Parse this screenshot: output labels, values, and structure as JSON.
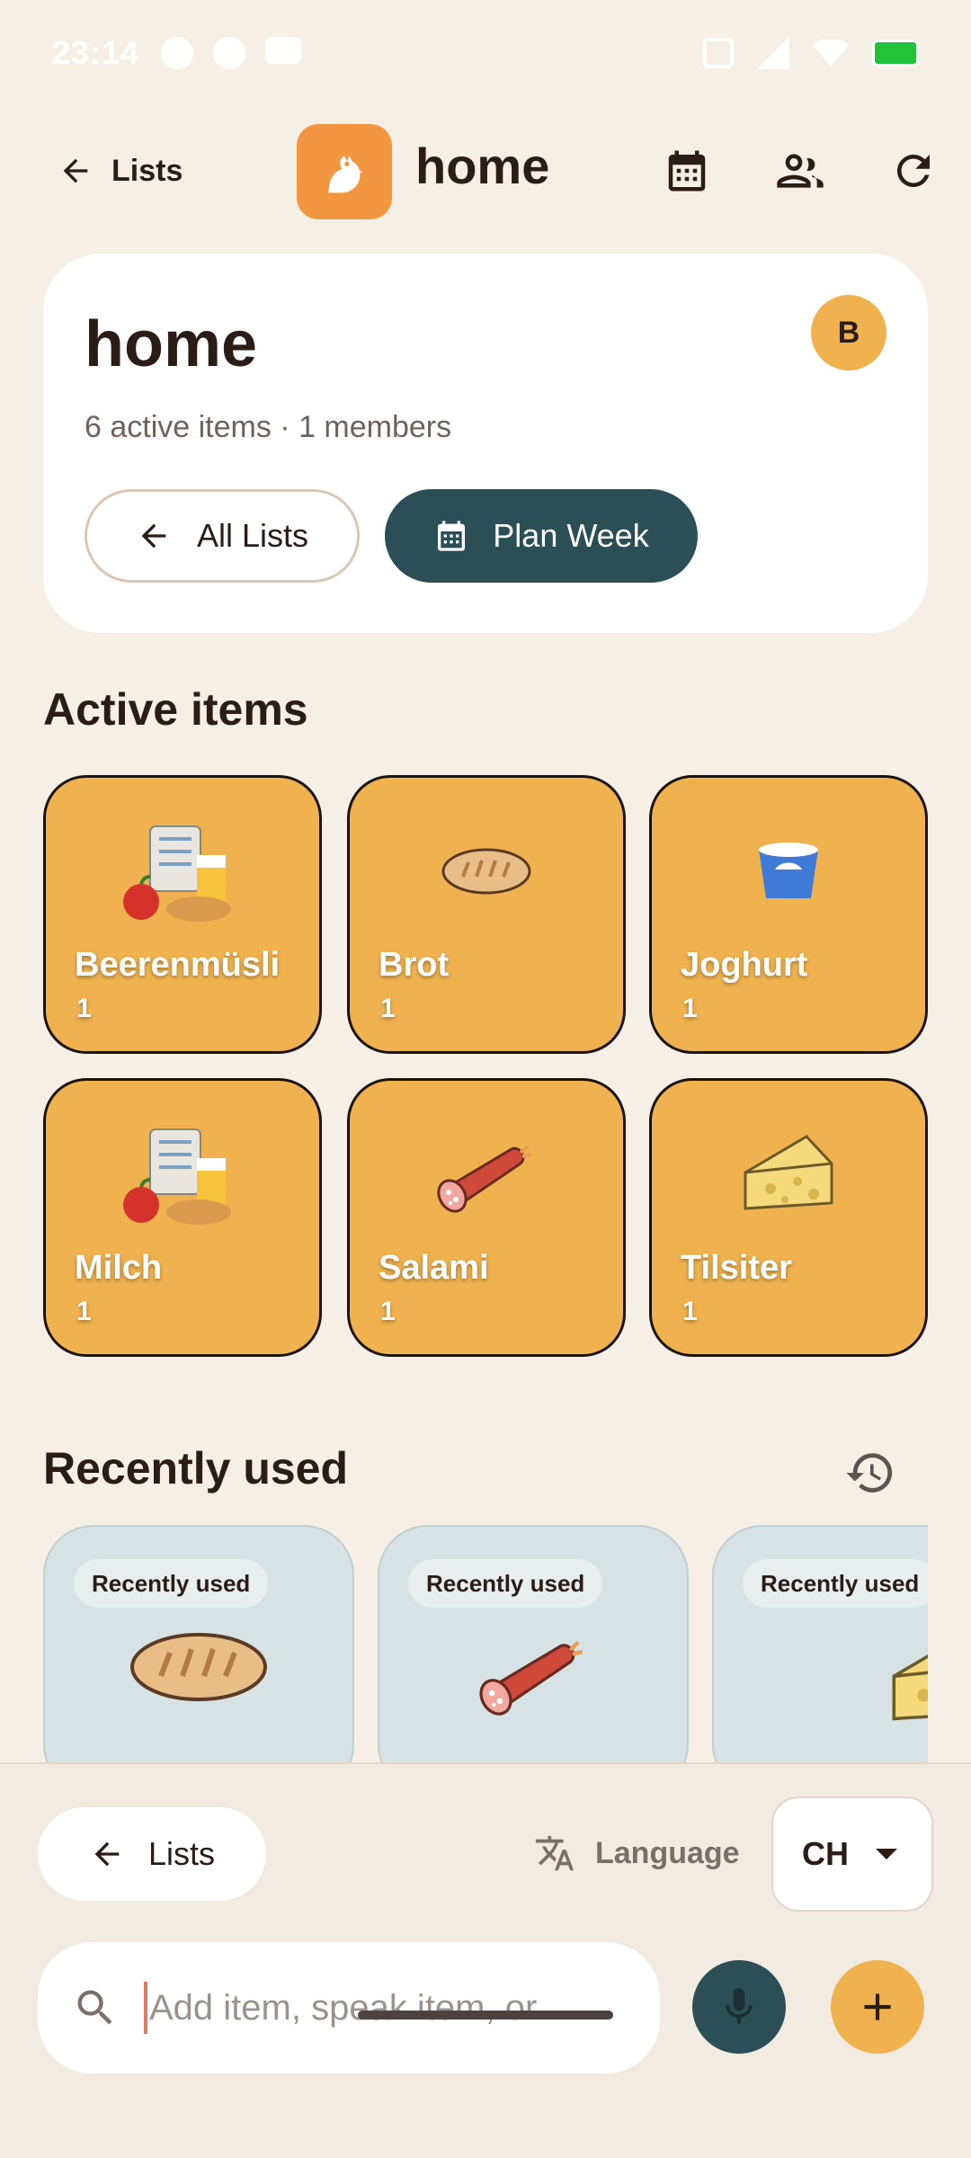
{
  "status_bar": {
    "time": "23:14"
  },
  "app_bar": {
    "back_label": "Lists",
    "title": "home",
    "icons": [
      "calendar-icon",
      "people-icon",
      "refresh-icon"
    ]
  },
  "header_card": {
    "title": "home",
    "avatar_letter": "B",
    "subtitle": "6 active items · 1 members",
    "all_lists_label": "All Lists",
    "plan_week_label": "Plan Week"
  },
  "active_items": {
    "heading": "Active items",
    "items": [
      {
        "name": "Beerenmüsli",
        "count": "1",
        "icon": "grocery-generic-icon"
      },
      {
        "name": "Brot",
        "count": "1",
        "icon": "bread-icon"
      },
      {
        "name": "Joghurt",
        "count": "1",
        "icon": "yogurt-icon"
      },
      {
        "name": "Milch",
        "count": "1",
        "icon": "grocery-generic-icon"
      },
      {
        "name": "Salami",
        "count": "1",
        "icon": "salami-icon"
      },
      {
        "name": "Tilsiter",
        "count": "1",
        "icon": "cheese-icon"
      }
    ]
  },
  "recently_used": {
    "heading": "Recently used",
    "cards": [
      {
        "chip": "Recently used",
        "icon": "bread-icon"
      },
      {
        "chip": "Recently used",
        "icon": "salami-icon"
      },
      {
        "chip": "Recently used",
        "icon": "cheese-icon"
      }
    ]
  },
  "bottom": {
    "lists_label": "Lists",
    "language_label": "Language",
    "language_value": "CH",
    "search_placeholder": "Add item, speak item, or…"
  },
  "colors": {
    "background": "#f6efe5",
    "tile": "#f0b24e",
    "primary_dark": "#2b4e57",
    "logo": "#f2973f",
    "recent_card": "#d6e2e4"
  }
}
